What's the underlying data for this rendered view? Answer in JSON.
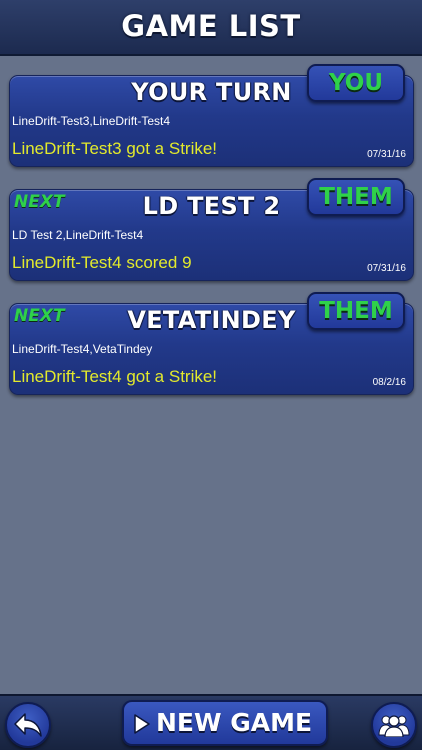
{
  "header": {
    "title": "Game List"
  },
  "games": [
    {
      "title": "Your Turn",
      "next_tag": "",
      "badge": "You",
      "players": "LineDrift-Test3,LineDrift-Test4",
      "status": "LineDrift-Test3 got a Strike!",
      "date": "07/31/16"
    },
    {
      "title": "LD Test 2",
      "next_tag": "Next",
      "badge": "Them",
      "players": "LD Test 2,LineDrift-Test4",
      "status": "LineDrift-Test4 scored 9",
      "date": "07/31/16"
    },
    {
      "title": "VetaTindey",
      "next_tag": "Next",
      "badge": "Them",
      "players": "LineDrift-Test4,VetaTindey",
      "status": "LineDrift-Test4 got a Strike!",
      "date": "08/2/16"
    }
  ],
  "footer": {
    "back_icon": "back-arrow-icon",
    "new_game_label": "New Game",
    "new_game_icon": "play-icon",
    "friends_icon": "friends-icon"
  },
  "colors": {
    "background": "#66728a",
    "card": "#22398a",
    "accent_green": "#2fd14a",
    "status_yellow": "#e3ea2c"
  }
}
